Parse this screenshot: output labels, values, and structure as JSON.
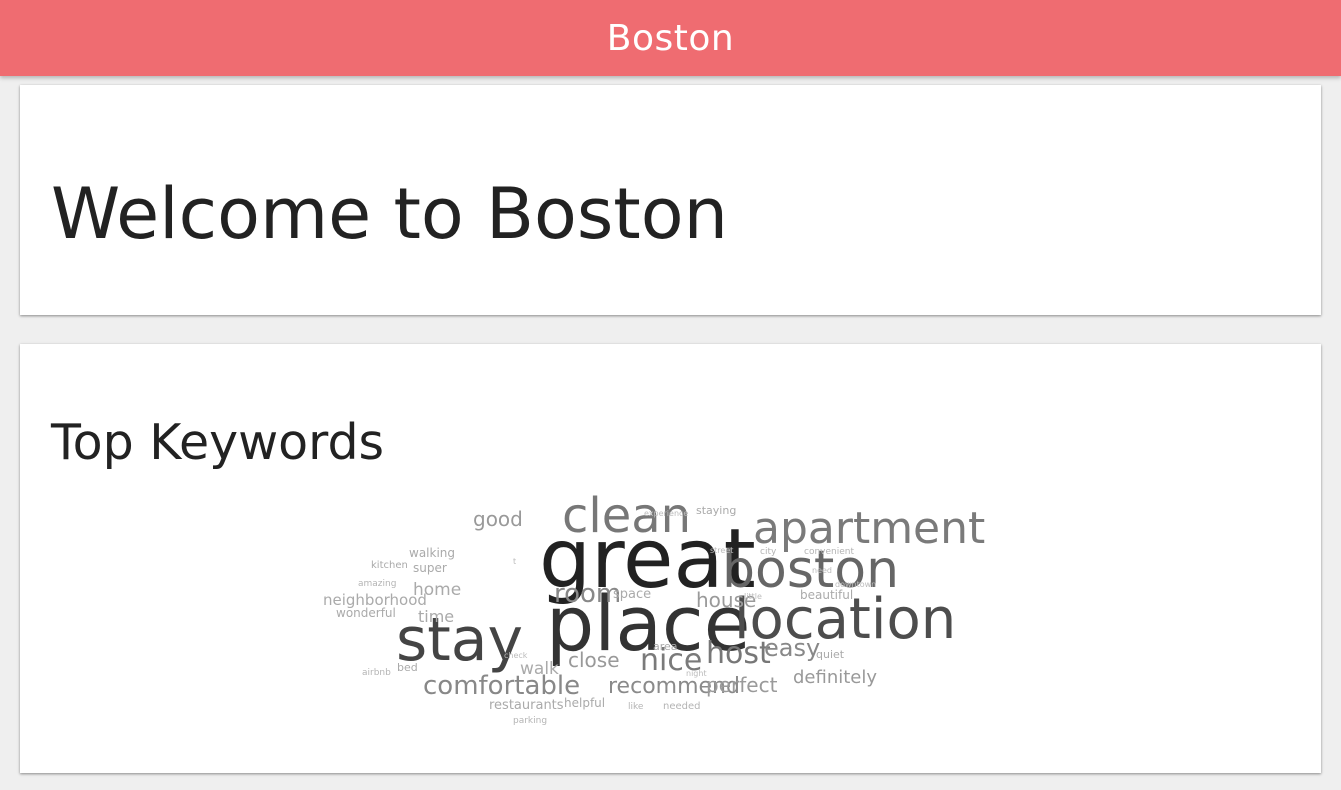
{
  "header": {
    "title": "Boston"
  },
  "welcome": {
    "title": "Welcome to Boston"
  },
  "keywords": {
    "title": "Top Keywords"
  },
  "colors": {
    "header_bg": "#ef6c71",
    "page_bg": "#efefef",
    "card_bg": "#ffffff",
    "text_dark": "#222222"
  },
  "word_cloud": [
    {
      "word": "great",
      "weight": 100,
      "color": "#222222"
    },
    {
      "word": "place",
      "weight": 92,
      "color": "#333333"
    },
    {
      "word": "stay",
      "weight": 80,
      "color": "#444444"
    },
    {
      "word": "location",
      "weight": 74,
      "color": "#4d4d4d"
    },
    {
      "word": "boston",
      "weight": 68,
      "color": "#666666"
    },
    {
      "word": "clean",
      "weight": 64,
      "color": "#777777"
    },
    {
      "word": "apartment",
      "weight": 60,
      "color": "#7a7a7a"
    },
    {
      "word": "host",
      "weight": 42,
      "color": "#777777"
    },
    {
      "word": "nice",
      "weight": 42,
      "color": "#7a7a7a"
    },
    {
      "word": "comfortable",
      "weight": 36,
      "color": "#888888"
    },
    {
      "word": "room",
      "weight": 34,
      "color": "#888888"
    },
    {
      "word": "easy",
      "weight": 32,
      "color": "#888888"
    },
    {
      "word": "recommend",
      "weight": 30,
      "color": "#8a8a8a"
    },
    {
      "word": "perfect",
      "weight": 28,
      "color": "#9a9a9a"
    },
    {
      "word": "house",
      "weight": 28,
      "color": "#9a9a9a"
    },
    {
      "word": "good",
      "weight": 26,
      "color": "#999999"
    },
    {
      "word": "close",
      "weight": 26,
      "color": "#999999"
    },
    {
      "word": "definitely",
      "weight": 24,
      "color": "#999999"
    },
    {
      "word": "walk",
      "weight": 22,
      "color": "#aaaaaa"
    },
    {
      "word": "home",
      "weight": 22,
      "color": "#aaaaaa"
    },
    {
      "word": "time",
      "weight": 20,
      "color": "#aaaaaa"
    },
    {
      "word": "neighborhood",
      "weight": 20,
      "color": "#aaaaaa"
    },
    {
      "word": "space",
      "weight": 16,
      "color": "#aaaaaa"
    },
    {
      "word": "restaurants",
      "weight": 16,
      "color": "#aaaaaa"
    },
    {
      "word": "super",
      "weight": 15,
      "color": "#aaaaaa"
    },
    {
      "word": "walking",
      "weight": 14,
      "color": "#aaaaaa"
    },
    {
      "word": "wonderful",
      "weight": 14,
      "color": "#aaaaaa"
    },
    {
      "word": "beautiful",
      "weight": 14,
      "color": "#aaaaaa"
    },
    {
      "word": "helpful",
      "weight": 14,
      "color": "#aaaaaa"
    },
    {
      "word": "quiet",
      "weight": 13,
      "color": "#aaaaaa"
    },
    {
      "word": "bed",
      "weight": 13,
      "color": "#aaaaaa"
    },
    {
      "word": "area",
      "weight": 13,
      "color": "#aaaaaa"
    },
    {
      "word": "staying",
      "weight": 12,
      "color": "#aaaaaa"
    },
    {
      "word": "kitchen",
      "weight": 11,
      "color": "#aaaaaa"
    },
    {
      "word": "convenient",
      "weight": 10,
      "color": "#b4b4b4"
    },
    {
      "word": "amazing",
      "weight": 10,
      "color": "#b4b4b4"
    },
    {
      "word": "airbnb",
      "weight": 10,
      "color": "#b4b4b4"
    },
    {
      "word": "city",
      "weight": 10,
      "color": "#b4b4b4"
    },
    {
      "word": "needed",
      "weight": 10,
      "color": "#b4b4b4"
    },
    {
      "word": "like",
      "weight": 10,
      "color": "#b4b4b4"
    },
    {
      "word": "parking",
      "weight": 10,
      "color": "#b4b4b4"
    },
    {
      "word": "street",
      "weight": 9,
      "color": "#bbbbbb"
    },
    {
      "word": "check",
      "weight": 9,
      "color": "#bbbbbb"
    },
    {
      "word": "experience",
      "weight": 9,
      "color": "#bbbbbb"
    },
    {
      "word": "downtown",
      "weight": 9,
      "color": "#bbbbbb"
    },
    {
      "word": "need",
      "weight": 9,
      "color": "#bbbbbb"
    },
    {
      "word": "little",
      "weight": 9,
      "color": "#bbbbbb"
    },
    {
      "word": "night",
      "weight": 9,
      "color": "#bbbbbb"
    },
    {
      "word": "t",
      "weight": 8,
      "color": "#bbbbbb"
    }
  ]
}
